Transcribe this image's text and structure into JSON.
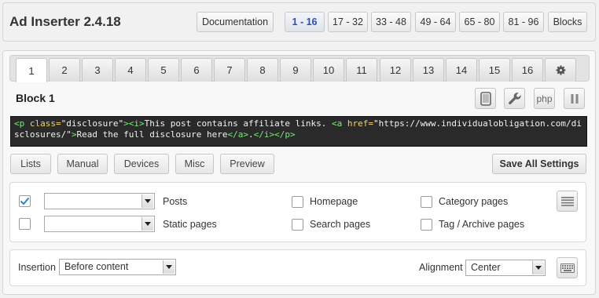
{
  "header": {
    "title": "Ad Inserter 2.4.18",
    "documentation_label": "Documentation",
    "ranges": [
      "1 - 16",
      "17 - 32",
      "33 - 48",
      "49 - 64",
      "65 - 80",
      "81 - 96"
    ],
    "blocks_label": "Blocks",
    "active_range": "1 - 16"
  },
  "tabs": [
    "1",
    "2",
    "3",
    "4",
    "5",
    "6",
    "7",
    "8",
    "9",
    "10",
    "11",
    "12",
    "13",
    "14",
    "15",
    "16"
  ],
  "active_tab": "1",
  "block": {
    "title": "Block 1",
    "php_label": "php"
  },
  "code": {
    "t1": "<p",
    "a1": " class=",
    "v1": "\"disclosure\"",
    "t2": "><i>",
    "s1": "This post contains affiliate links. ",
    "t3": "<a",
    "a2": " href=",
    "v2": "\"https://www.individualobligation.com/disclosures/\"",
    "t4": ">",
    "s2": "Read the full disclosure here",
    "t5": "</a>",
    "s3": ".",
    "t6": "</i></p>"
  },
  "toolbar": {
    "lists": "Lists",
    "manual": "Manual",
    "devices": "Devices",
    "misc": "Misc",
    "preview": "Preview",
    "save_all": "Save All Settings"
  },
  "display": {
    "posts_label": "Posts",
    "posts_checked": true,
    "static_pages_label": "Static pages",
    "static_pages_checked": false,
    "homepage_label": "Homepage",
    "search_pages_label": "Search pages",
    "category_pages_label": "Category pages",
    "tag_archive_label": "Tag / Archive pages",
    "posts_select_value": "",
    "static_select_value": ""
  },
  "insertion": {
    "label": "Insertion",
    "value": "Before content",
    "alignment_label": "Alignment",
    "alignment_value": "Center"
  },
  "colors": {
    "active_range_text": "#2a4fb8",
    "code_bg": "#2a2a2a",
    "code_tag": "#6ef16e",
    "code_attr": "#f3d36b",
    "checkmark": "#1e8cbe"
  }
}
